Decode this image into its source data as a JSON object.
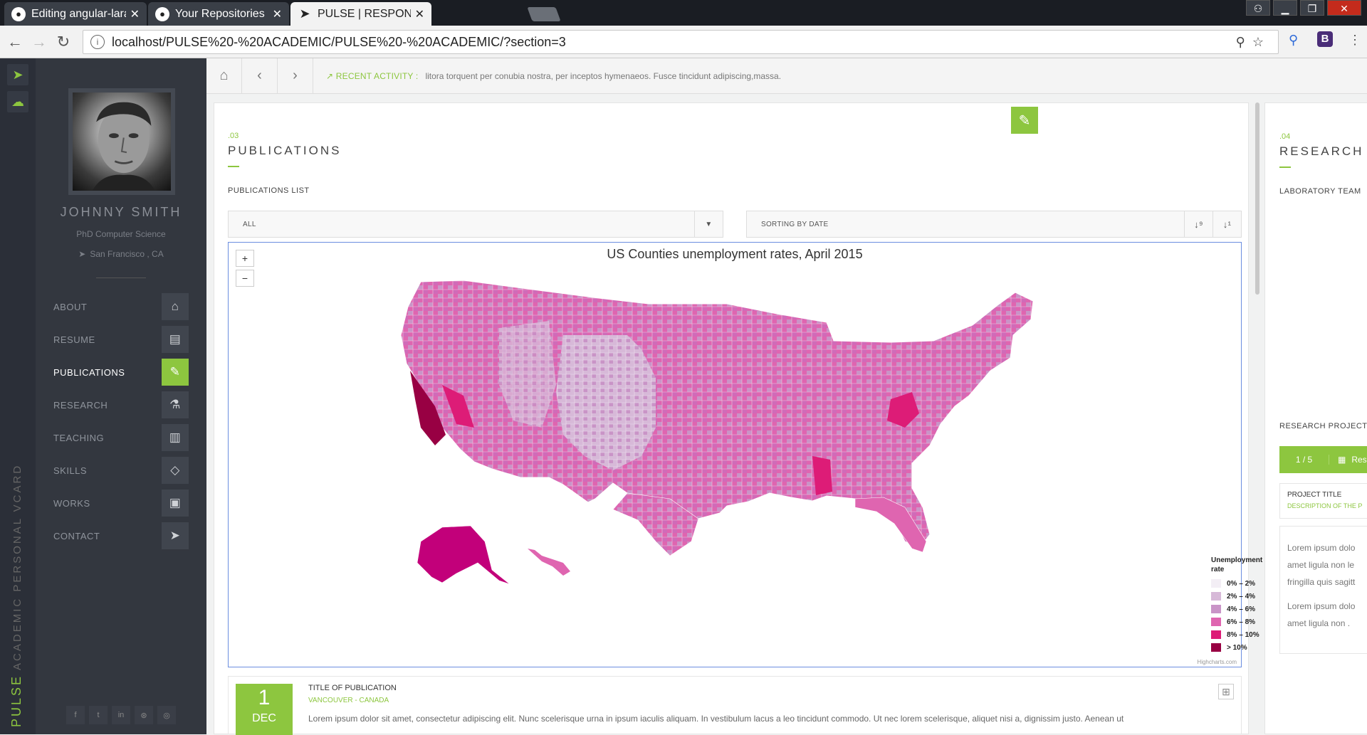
{
  "browser": {
    "tabs": [
      {
        "label": "Editing angular-laravel-le",
        "icon": "github-icon"
      },
      {
        "label": "Your Repositories",
        "icon": "github-icon"
      },
      {
        "label": "PULSE | RESPONSIVE ACA",
        "icon": "cursor-icon"
      }
    ],
    "url": "localhost/PULSE%20-%20ACADEMIC/PULSE%20-%20ACADEMIC/?section=3",
    "info_glyph": "i"
  },
  "sidebar": {
    "name": "JOHNNY SMITH",
    "role": "PhD Computer Science",
    "location": "San Francisco , CA",
    "vertical_brand": "PULSE",
    "vertical_tagline": "ACADEMIC PERSONAL VCARD",
    "nav": [
      {
        "label": "ABOUT",
        "icon": "home-icon",
        "active": false
      },
      {
        "label": "RESUME",
        "icon": "newspaper-icon",
        "active": false
      },
      {
        "label": "PUBLICATIONS",
        "icon": "pencil-icon",
        "active": true
      },
      {
        "label": "RESEARCH",
        "icon": "flask-icon",
        "active": false
      },
      {
        "label": "TEACHING",
        "icon": "book-icon",
        "active": false
      },
      {
        "label": "SKILLS",
        "icon": "diamond-icon",
        "active": false
      },
      {
        "label": "WORKS",
        "icon": "archive-icon",
        "active": false
      },
      {
        "label": "CONTACT",
        "icon": "paper-plane-icon",
        "active": false
      }
    ],
    "social": [
      "f",
      "t",
      "in",
      "⊛",
      "◎"
    ]
  },
  "topbar": {
    "recent_label": "RECENT ACTIVITY :",
    "recent_text": "litora torquent per conubia nostra, per inceptos hymenaeos. Fusce tincidunt adipiscing,massa."
  },
  "publications": {
    "number": ".03",
    "title": "PUBLICATIONS",
    "list_label": "PUBLICATIONS LIST",
    "filter_value": "ALL",
    "sort_value": "SORTING BY DATE",
    "item": {
      "day": "1",
      "month": "DEC",
      "title": "TITLE OF PUBLICATION",
      "location": "VANCOUVER - CANADA",
      "body": "Lorem ipsum dolor sit amet, consectetur adipiscing elit. Nunc scelerisque urna in ipsum iaculis aliquam. In vestibulum lacus a leo tincidunt commodo. Ut nec lorem scelerisque, aliquet nisi a, dignissim justo. Aenean ut"
    }
  },
  "map": {
    "title": "US Counties unemployment rates, April 2015",
    "zoom_in": "+",
    "zoom_out": "−",
    "credit": "Highcharts.com",
    "legend_title": "Unemployment rate",
    "legend": [
      {
        "label": "0% – 2%",
        "color": "#f3eef5"
      },
      {
        "label": "2% – 4%",
        "color": "#d7b9d8"
      },
      {
        "label": "4% – 6%",
        "color": "#c994c7"
      },
      {
        "label": "6% – 8%",
        "color": "#df65b0"
      },
      {
        "label": "8% – 10%",
        "color": "#dd1c77"
      },
      {
        "label": "> 10%",
        "color": "#980043"
      }
    ]
  },
  "research": {
    "number": ".04",
    "title": "RESEARCH",
    "team_label": "LABORATORY TEAM",
    "projects_label": "RESEARCH PROJECT",
    "pager": "1 / 5",
    "pager_btn": "Res",
    "project_title": "PROJECT TITLE",
    "project_desc": "DESCRIPTION OF THE P",
    "text1a": "Lorem ipsum dolo",
    "text1b": "amet ligula non le",
    "text1c": "fringilla quis sagitt",
    "text2a": "Lorem ipsum dolo",
    "text2b": "amet ligula non ."
  },
  "colors": {
    "accent": "#8dc63f",
    "sidebar": "#33373f"
  }
}
